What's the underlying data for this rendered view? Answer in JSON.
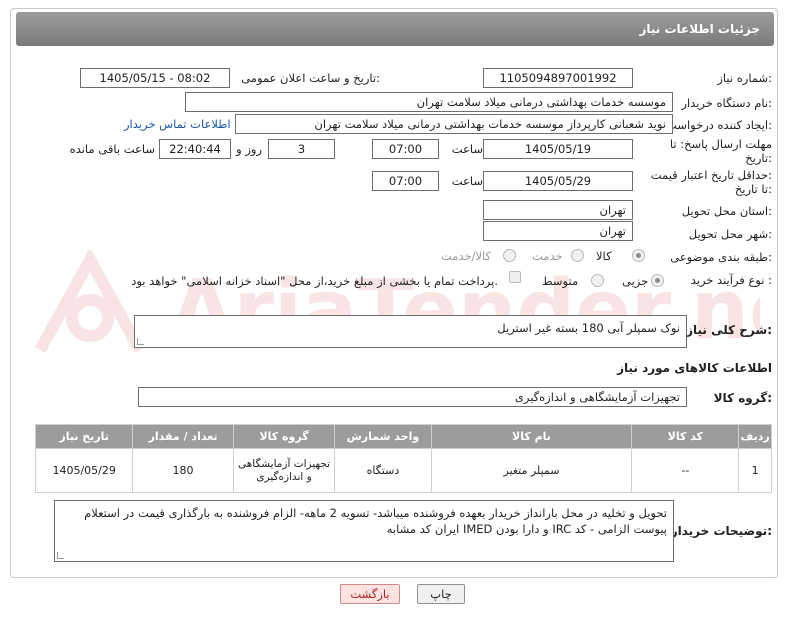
{
  "header": {
    "title": "جزئیات اطلاعات نیاز"
  },
  "fields": {
    "need_number_label": "شماره نیاز:",
    "need_number": "1105094897001992",
    "announce_label": "تاریخ و ساعت اعلان عمومی:",
    "announce_value": "1405/05/15 - 08:02",
    "buyer_org_label": "نام دستگاه خریدار:",
    "buyer_org": "موسسه خدمات بهداشتی درمانی میلاد سلامت تهران",
    "creator_label": "ایجاد کننده درخواست:",
    "creator": "نوید شعبانی کارپرداز موسسه خدمات بهداشتی درمانی میلاد سلامت تهران",
    "contact_link": "اطلاعات تماس خریدار",
    "deadline_label_1": "مهلت ارسال پاسخ: تا",
    "deadline_label_2": "تاریخ:",
    "deadline_date": "1405/05/19",
    "time_label": "ساعت",
    "deadline_time": "07:00",
    "days_value": "3",
    "days_label": "روز و",
    "remaining_time": "22:40:44",
    "remaining_label": "ساعت باقی مانده",
    "validity_label_1": "حداقل تاریخ اعتبار قیمت:",
    "validity_label_2": "تا تاریخ:",
    "validity_date": "1405/05/29",
    "validity_time_label": "ساعت",
    "validity_time": "07:00",
    "province_label": "استان محل تحویل:",
    "province": "تهران",
    "city_label": "شهر محل تحویل:",
    "city": "تهران",
    "category_label": "طبقه بندی موضوعی:",
    "category_options": [
      "کالا",
      "خدمت",
      "کالا/خدمت"
    ],
    "process_label": "نوع فرآیند خرید :",
    "process_options": [
      "جزیی",
      "متوسط"
    ],
    "payment_note": "پرداخت تمام یا بخشی از مبلغ خرید،از محل \"اسناد خزانه اسلامی\" خواهد بود."
  },
  "description": {
    "label": "شرح کلی نیاز:",
    "value": "نوک سمپلر آبی  180 بسته غیر استریل"
  },
  "goods": {
    "section_title": "اطلاعات کالاهای مورد نیاز",
    "group_label": "گروه کالا:",
    "group_value": "تجهیزات آزمایشگاهی و اندازه‌گیری",
    "columns": [
      "ردیف",
      "کد کالا",
      "نام کالا",
      "واحد شمارش",
      "گروه کالا",
      "تعداد / مقدار",
      "تاریخ نیاز"
    ],
    "rows": [
      {
        "row": "1",
        "code": "--",
        "name": "سمپلر متغیر",
        "unit": "دستگاه",
        "group": "تجهیزات آزمایشگاهی و اندازه‌گیری",
        "qty": "180",
        "date": "1405/05/29"
      }
    ]
  },
  "buyer_notes": {
    "label": "توضیحات خریدار:",
    "value": "تحویل و تخلیه در محل بارانداز خریدار بعهده فروشنده میباشد- تسویه 2 ماهه- الزام فروشنده به بارگذاری قیمت در استعلام پیوست الزامی - کد IRC و دارا بودن IMED  ایران کد مشابه"
  },
  "buttons": {
    "print": "چاپ",
    "back": "بازگشت"
  },
  "watermark": {
    "text": "AriaTender.neT"
  },
  "colors": {
    "header": "#8a8a8a",
    "link": "#1a55a8",
    "back_bg": "#fde2e2",
    "back_text": "#b02020"
  }
}
